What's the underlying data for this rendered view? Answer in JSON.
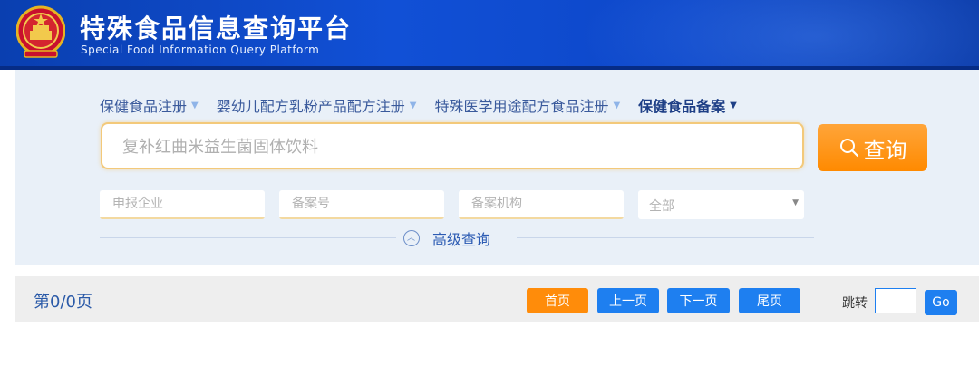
{
  "header": {
    "title": "特殊食品信息查询平台",
    "subtitle": "Special Food Information Query Platform",
    "emblem_icon": "national-emblem-icon",
    "colors": {
      "primary": "#1150d6",
      "accent": "#ff8c0a"
    }
  },
  "search": {
    "tabs": [
      {
        "label": "保健食品注册",
        "active": false
      },
      {
        "label": "婴幼儿配方乳粉产品配方注册",
        "active": false
      },
      {
        "label": "特殊医学用途配方食品注册",
        "active": false
      },
      {
        "label": "保健食品备案",
        "active": true
      }
    ],
    "tab_caret": "▼",
    "placeholder": "复补红曲米益生菌固体饮料",
    "button_label": "查询",
    "filters": {
      "company_placeholder": "申报企业",
      "record_no_placeholder": "备案号",
      "agency_placeholder": "备案机构",
      "scope_value": "全部"
    },
    "advanced_label": "高级查询"
  },
  "pager": {
    "page_status": "第0/0页",
    "first": "首页",
    "prev": "上一页",
    "next": "下一页",
    "last": "尾页",
    "jump_label": "跳转",
    "go": "Go"
  }
}
